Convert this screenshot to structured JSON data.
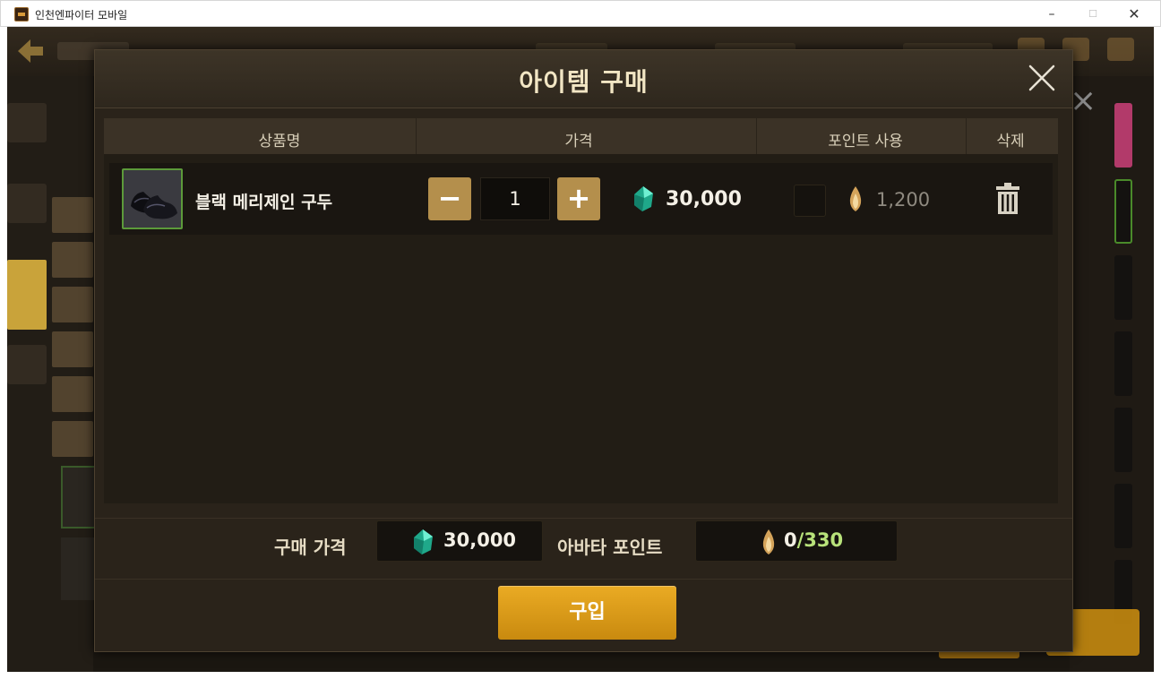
{
  "window": {
    "title": "인천엔파이터 모바일",
    "minimize": "–",
    "maximize": "☐",
    "close": "✕"
  },
  "dialog": {
    "title": "아이템 구매",
    "columns": {
      "name": "상품명",
      "price": "가격",
      "points": "포인트 사용",
      "delete": "삭제"
    },
    "items": [
      {
        "name": "블랙 메리제인 구두",
        "quantity": "1",
        "price": "30,000",
        "points": "1,200",
        "use_points": false
      }
    ],
    "summary": {
      "price_label": "구매 가격",
      "price_value": "30,000",
      "points_label": "아바타 포인트",
      "points_current": "0",
      "points_max": "/330"
    },
    "buy_label": "구입"
  },
  "icons": {
    "back": "back-arrow-icon",
    "close": "close-icon",
    "gem": "gem-icon",
    "flame": "point-flame-icon",
    "trash": "trash-icon"
  },
  "colors": {
    "accent": "#e0a020",
    "gem": "#2ec7a6",
    "points_max": "#b8e27a",
    "thumb_border": "#5c9a3a"
  }
}
